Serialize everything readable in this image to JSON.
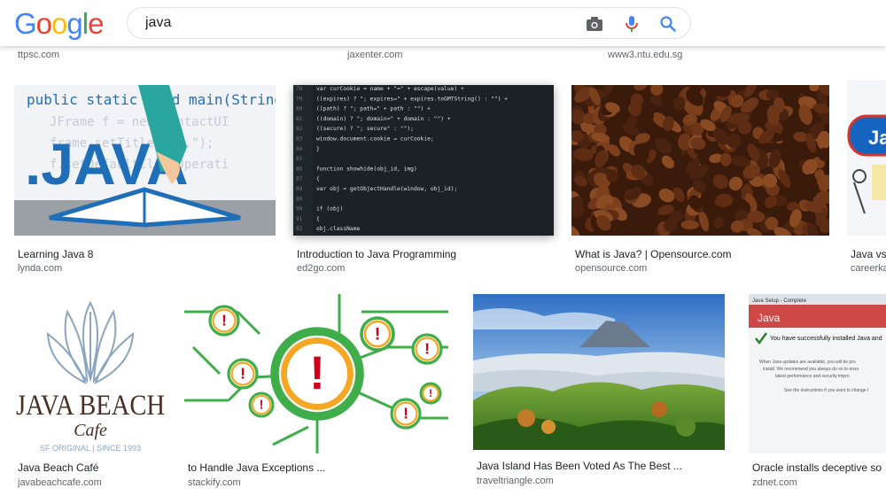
{
  "search": {
    "query": "java",
    "logo_letters": [
      {
        "ch": "G",
        "color": "#4285F4"
      },
      {
        "ch": "o",
        "color": "#EA4335"
      },
      {
        "ch": "o",
        "color": "#FBBC05"
      },
      {
        "ch": "g",
        "color": "#4285F4"
      },
      {
        "ch": "l",
        "color": "#34A853"
      },
      {
        "ch": "e",
        "color": "#EA4335"
      }
    ],
    "icons": [
      "camera-icon",
      "microphone-icon",
      "search-icon"
    ]
  },
  "prev_row_sources": [
    "ttpsc.com",
    "jaxenter.com",
    "www3.ntu.edu.sg"
  ],
  "row1": [
    {
      "title": "Learning Java 8",
      "source": "lynda.com",
      "image_text": "public static void main(String[] JFrame f = new JFrame .JAVA"
    },
    {
      "title": "Introduction to Java Programming",
      "source": "ed2go.com",
      "code_lines": [
        {
          "n": "78",
          "t": "    var curCookie = name + \"=\" + escape(value) +"
        },
        {
          "n": "79",
          "t": "        ((expires) ? \"; expires=\" + expires.toGMTString() : \"\") +"
        },
        {
          "n": "80",
          "t": "        ((path) ? \"; path=\" + path : \"\") +"
        },
        {
          "n": "81",
          "t": "        ((domain) ? \"; domain=\" + domain : \"\") +"
        },
        {
          "n": "82",
          "t": "        ((secure) ? \"; secure\" : \"\");"
        },
        {
          "n": "83",
          "t": "    window.document.cookie = curCookie;"
        },
        {
          "n": "84",
          "t": "}"
        },
        {
          "n": "85",
          "t": ""
        },
        {
          "n": "86",
          "t": "function showhide(obj_id, img)"
        },
        {
          "n": "87",
          "t": "{"
        },
        {
          "n": "88",
          "t": "    var obj = getObjectHandle(window, obj_id);"
        },
        {
          "n": "89",
          "t": ""
        },
        {
          "n": "90",
          "t": "    if (obj)"
        },
        {
          "n": "91",
          "t": "    {"
        },
        {
          "n": "92",
          "t": "        obj.className"
        }
      ]
    },
    {
      "title": "What is Java? | Opensource.com",
      "source": "opensource.com"
    },
    {
      "title": "Java vs",
      "source": "careerka",
      "badge": "Ja"
    }
  ],
  "row2": [
    {
      "title": "Java Beach Café",
      "source": "javabeachcafe.com",
      "logo_main": "JAVA BEACH",
      "logo_script": "Cafe",
      "logo_tag": "SF ORIGINAL  |  SINCE 1993"
    },
    {
      "title": "to Handle Java Exceptions ...",
      "source": "stackify.com",
      "mark": "!"
    },
    {
      "title": "Java Island Has Been Voted As The Best ...",
      "source": "traveltriangle.com"
    },
    {
      "title": "Oracle installs deceptive so",
      "source": "zdnet.com",
      "dialog_title": "Java Setup - Complete",
      "dialog_brand": "Java",
      "dialog_msg": "You have successfully installed Java and",
      "dialog_body": "When Java updates are available, you will be prompted to install. We recommend you always do so to ensure you have the latest performance and security improvements.",
      "dialog_link": "See the instructions if you want to change t"
    }
  ],
  "colors": {
    "accent_blue": "#4285F4",
    "mic_red": "#EA4335",
    "java_blue": "#1f6fb8",
    "coffee": "#5a2e16"
  }
}
